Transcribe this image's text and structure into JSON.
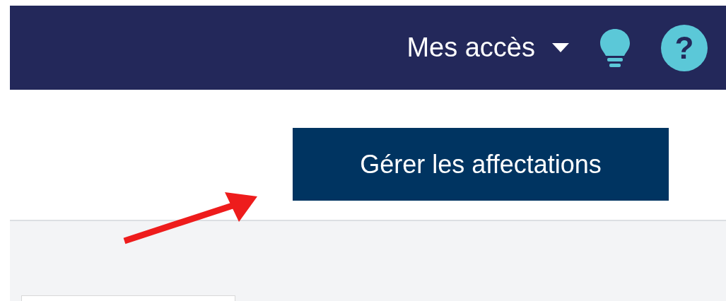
{
  "navbar": {
    "access_menu": {
      "label": "Mes accès",
      "expanded": false
    },
    "help_glyph": "?"
  },
  "actions": {
    "manage_button": "Gérer les affectations"
  },
  "annotation": {
    "kind": "arrow"
  }
}
